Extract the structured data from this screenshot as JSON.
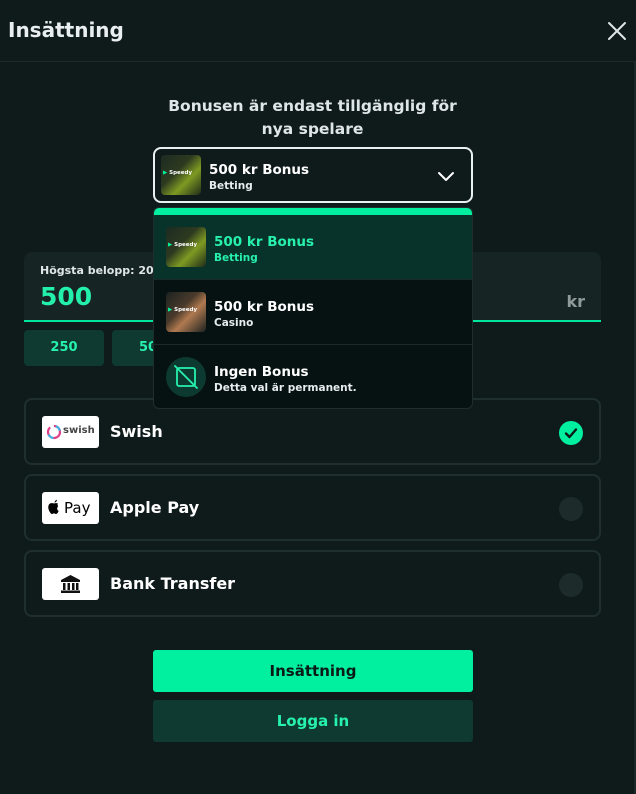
{
  "header": {
    "title": "Insättning"
  },
  "bonus": {
    "notice": "Bonusen är endast tillgänglig för nya spelare",
    "selected": {
      "title": "500 kr Bonus",
      "subtitle": "Betting",
      "brand": "Speedy"
    },
    "options": [
      {
        "title": "500 kr Bonus",
        "subtitle": "Betting",
        "brand": "Speedy"
      },
      {
        "title": "500 kr Bonus",
        "subtitle": "Casino",
        "brand": "Speedy"
      },
      {
        "title": "Ingen Bonus",
        "subtitle": "Detta val är permanent."
      }
    ]
  },
  "amount": {
    "label": "Högsta belopp: 20 0",
    "value": "500",
    "unit": "kr"
  },
  "quick_amounts": [
    "250",
    "50"
  ],
  "methods": [
    {
      "name": "Swish",
      "logo_text": "swish",
      "checked": true
    },
    {
      "name": "Apple Pay",
      "logo_text": "Pay",
      "checked": false
    },
    {
      "name": "Bank Transfer",
      "checked": false
    }
  ],
  "buttons": {
    "deposit": "Insättning",
    "login": "Logga in"
  },
  "colors": {
    "accent": "#00f0a0",
    "background": "#0f1b1b",
    "accent_dark": "#0e3a31"
  }
}
